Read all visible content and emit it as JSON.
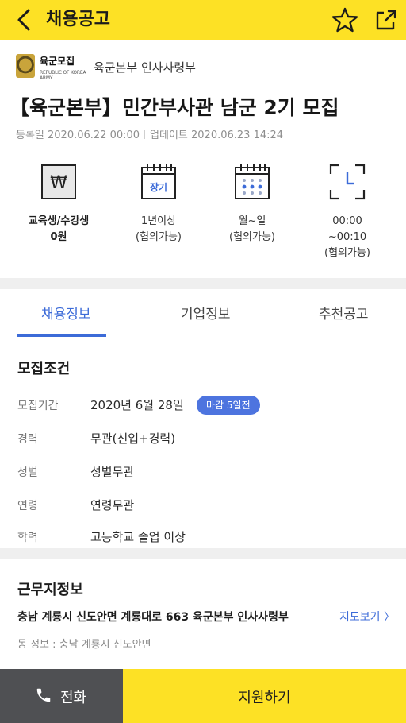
{
  "appbar": {
    "title": "채용공고",
    "back_icon": "chevron-left-icon",
    "favorite_icon": "star-outline-icon",
    "share_icon": "share-icon",
    "accent": "#fde125"
  },
  "company": {
    "logo_text": "육군모집",
    "logo_sub": "REPUBLIC OF KOREA ARMY",
    "name": "육군본부 인사사령부"
  },
  "job": {
    "title": "【육군본부】민간부사관 남군 2기 모집",
    "registered": "등록일 2020.06.22 00:00",
    "updated": "업데이트 2020.06.23 14:24"
  },
  "conditions": [
    {
      "icon": "won-icon",
      "line1": "교육생/수강생",
      "line2": "0원",
      "line3": ""
    },
    {
      "icon": "calendar-long-term-icon",
      "icon_text": "장기",
      "line1": "1년이상",
      "line2": "(협의가능)",
      "line3": ""
    },
    {
      "icon": "calendar-days-icon",
      "line1": "월~일",
      "line2": "(협의가능)",
      "line3": ""
    },
    {
      "icon": "clock-icon",
      "line1": "00:00",
      "line2": "~00:10",
      "line3": "(협의가능)"
    }
  ],
  "tabs": [
    {
      "label": "채용정보",
      "active": true
    },
    {
      "label": "기업정보",
      "active": false
    },
    {
      "label": "추천공고",
      "active": false
    }
  ],
  "recruit": {
    "title": "모집조건",
    "rows": [
      {
        "label": "모집기간",
        "value": "2020년 6월 28일"
      },
      {
        "label": "경력",
        "value": "무관(신입+경력)"
      },
      {
        "label": "성별",
        "value": "성별무관"
      },
      {
        "label": "연령",
        "value": "연령무관"
      },
      {
        "label": "학력",
        "value": "고등학교 졸업 이상"
      }
    ],
    "deadline_badge": "마감 5일전"
  },
  "location": {
    "title": "근무지정보",
    "address": "충남 계룡시 신도안면 계룡대로 663 육군본부 인사사령부",
    "map_link": "지도보기 〉",
    "dong": "동 정보 : 충남 계룡시 신도안면"
  },
  "bottom": {
    "call_label": "전화",
    "apply_label": "지원하기",
    "phone_icon": "phone-icon"
  },
  "colors": {
    "accent_yellow": "#fde125",
    "link_blue": "#3c6bd8",
    "badge_blue": "#4d74df",
    "call_gray": "#4f5053"
  }
}
